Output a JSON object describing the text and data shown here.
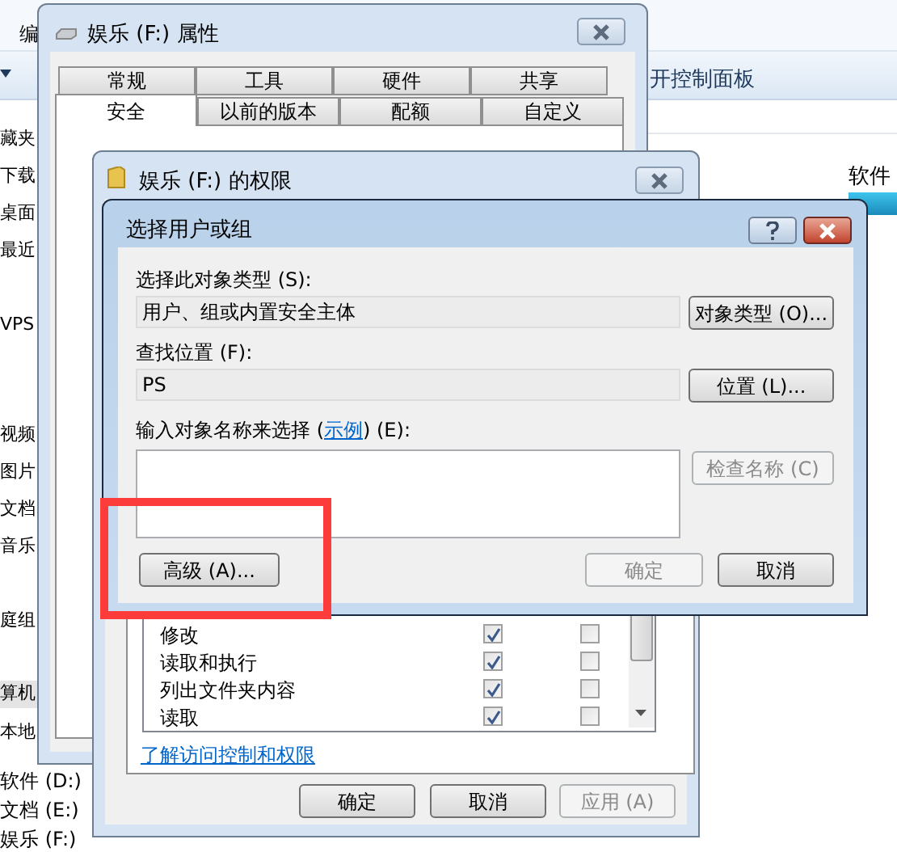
{
  "explorer": {
    "menu_fragment": "编",
    "toolbar_item": "开控制面板",
    "column_header": "软件",
    "nav_items": [
      {
        "label": "藏夹",
        "selected": false
      },
      {
        "label": "下载",
        "selected": false
      },
      {
        "label": "桌面",
        "selected": false
      },
      {
        "label": "最近",
        "selected": false
      },
      {
        "label": "VPS",
        "selected": false
      },
      {
        "label": "视频",
        "selected": false
      },
      {
        "label": "图片",
        "selected": false
      },
      {
        "label": "文档",
        "selected": false
      },
      {
        "label": "音乐",
        "selected": false
      },
      {
        "label": "庭组",
        "selected": false
      },
      {
        "label": "算机",
        "selected": true
      },
      {
        "label": "本地",
        "selected": false
      },
      {
        "label": "软件 (D:)",
        "selected": false
      },
      {
        "label": "文档 (E:)",
        "selected": false
      },
      {
        "label": "娱乐 (F:)",
        "selected": false
      }
    ]
  },
  "properties_window": {
    "title": "娱乐 (F:) 属性",
    "tabs_back": [
      {
        "label": "常规",
        "selected": false
      },
      {
        "label": "工具",
        "selected": false
      },
      {
        "label": "硬件",
        "selected": false
      },
      {
        "label": "共享",
        "selected": false
      }
    ],
    "tabs_front": [
      {
        "label": "安全",
        "selected": true
      },
      {
        "label": "以前的版本",
        "selected": false
      },
      {
        "label": "配额",
        "selected": false
      },
      {
        "label": "自定义",
        "selected": false
      }
    ]
  },
  "permissions_window": {
    "title": "娱乐 (F:) 的权限",
    "permissions": [
      {
        "name": "修改",
        "allow": true,
        "deny": false
      },
      {
        "name": "读取和执行",
        "allow": true,
        "deny": false
      },
      {
        "name": "列出文件夹内容",
        "allow": true,
        "deny": false
      },
      {
        "name": "读取",
        "allow": true,
        "deny": false
      }
    ],
    "link": "了解访问控制和权限",
    "buttons": [
      {
        "label": "确定",
        "disabled": false
      },
      {
        "label": "取消",
        "disabled": false
      },
      {
        "label": "应用 (A)",
        "disabled": true
      }
    ]
  },
  "select_dialog": {
    "title": "选择用户或组",
    "object_type_label": "选择此对象类型 (S):",
    "object_type_value": "用户、组或内置安全主体",
    "object_type_button": "对象类型 (O)...",
    "location_label": "查找位置 (F):",
    "location_value": "PS",
    "location_button": "位置 (L)...",
    "names_label_before": "输入对象名称来选择 (",
    "names_label_link": "示例",
    "names_label_after": ") (E):",
    "check_names_button": {
      "label": "检查名称 (C)",
      "disabled": true
    },
    "advanced_button": {
      "label": "高级 (A)...",
      "disabled": false
    },
    "ok_button": {
      "label": "确定",
      "disabled": true
    },
    "cancel_button": {
      "label": "取消",
      "disabled": false
    }
  }
}
